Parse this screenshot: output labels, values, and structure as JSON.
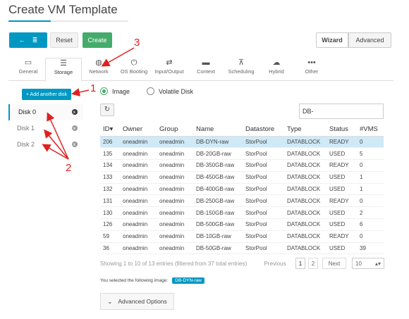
{
  "page": {
    "title": "Create VM Template"
  },
  "toolbar": {
    "reset_label": "Reset",
    "create_label": "Create",
    "back_icon": "←",
    "list_icon": "≣"
  },
  "mode": {
    "wizard_label": "Wizard",
    "advanced_label": "Advanced"
  },
  "tabs": [
    {
      "label": "General",
      "icon": "laptop-icon",
      "glyph": "▭"
    },
    {
      "label": "Storage",
      "icon": "storage-icon",
      "glyph": "☰"
    },
    {
      "label": "Network",
      "icon": "globe-icon",
      "glyph": "◍"
    },
    {
      "label": "OS Booting",
      "icon": "power-icon",
      "glyph": "⏻"
    },
    {
      "label": "Input/Output",
      "icon": "exchange-icon",
      "glyph": "⇄"
    },
    {
      "label": "Context",
      "icon": "folder-icon",
      "glyph": "▬"
    },
    {
      "label": "Scheduling",
      "icon": "sitemap-icon",
      "glyph": "⊼"
    },
    {
      "label": "Hybrid",
      "icon": "cloud-icon",
      "glyph": "☁"
    },
    {
      "label": "Other",
      "icon": "ellipsis-icon",
      "glyph": "•••"
    }
  ],
  "storage": {
    "add_disk_label": "+ Add another disk",
    "disks": [
      {
        "label": "Disk 0"
      },
      {
        "label": "Disk 1"
      },
      {
        "label": "Disk 2"
      }
    ],
    "source_image_label": "Image",
    "source_volatile_label": "Volatile Disk",
    "refresh_glyph": "↻",
    "search_value": "DB-"
  },
  "table": {
    "columns": [
      "ID",
      "Owner",
      "Group",
      "Name",
      "Datastore",
      "Type",
      "Status",
      "#VMS"
    ],
    "sort_glyph": "▾",
    "rows": [
      [
        "206",
        "oneadmin",
        "oneadmin",
        "DB-DYN-raw",
        "StorPool",
        "DATABLOCK",
        "READY",
        "0"
      ],
      [
        "135",
        "oneadmin",
        "oneadmin",
        "DB-20GB-raw",
        "StorPool",
        "DATABLOCK",
        "USED",
        "5"
      ],
      [
        "134",
        "oneadmin",
        "oneadmin",
        "DB-350GB-raw",
        "StorPool",
        "DATABLOCK",
        "READY",
        "0"
      ],
      [
        "133",
        "oneadmin",
        "oneadmin",
        "DB-450GB-raw",
        "StorPool",
        "DATABLOCK",
        "USED",
        "1"
      ],
      [
        "132",
        "oneadmin",
        "oneadmin",
        "DB-400GB-raw",
        "StorPool",
        "DATABLOCK",
        "USED",
        "1"
      ],
      [
        "131",
        "oneadmin",
        "oneadmin",
        "DB-250GB-raw",
        "StorPool",
        "DATABLOCK",
        "READY",
        "0"
      ],
      [
        "130",
        "oneadmin",
        "oneadmin",
        "DB-150GB-raw",
        "StorPool",
        "DATABLOCK",
        "USED",
        "2"
      ],
      [
        "126",
        "oneadmin",
        "oneadmin",
        "DB-500GB-raw",
        "StorPool",
        "DATABLOCK",
        "USED",
        "6"
      ],
      [
        "59",
        "oneadmin",
        "oneadmin",
        "DB-10GB-raw",
        "StorPool",
        "DATABLOCK",
        "READY",
        "0"
      ],
      [
        "36",
        "oneadmin",
        "oneadmin",
        "DB-50GB-raw",
        "StorPool",
        "DATABLOCK",
        "USED",
        "39"
      ]
    ]
  },
  "pagination": {
    "info": "Showing 1 to 10 of 13 entries (filtered from 37 total entries)",
    "previous": "Previous",
    "page1": "1",
    "page2": "2",
    "next": "Next",
    "page_size": "10",
    "page_size_caret": "▴▾"
  },
  "selection": {
    "label": "You selected the following image:",
    "value": "DB-DYN-raw"
  },
  "advanced_options": {
    "label": "Advanced Options",
    "chevron": "⌄"
  },
  "annotations": {
    "n1": "1",
    "n2": "2",
    "n3": "3"
  },
  "colors": {
    "accent": "#0098c3",
    "create": "#43ac6a",
    "arrow": "#e02020",
    "selected_row": "#cfe9f6"
  }
}
